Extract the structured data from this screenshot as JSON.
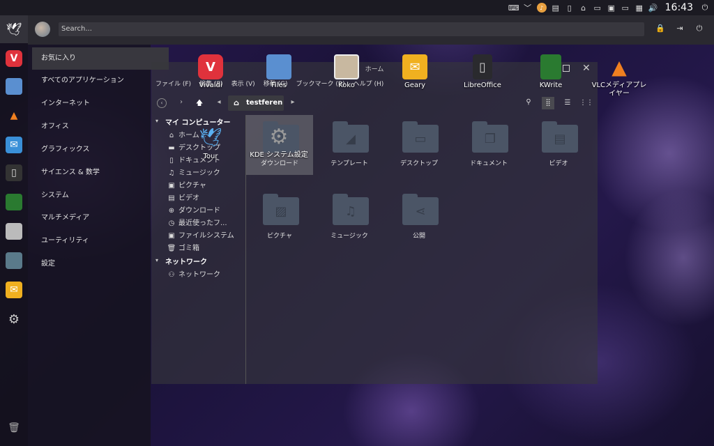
{
  "panel": {
    "clock": "16:43"
  },
  "menu": {
    "search_placeholder": "Search...",
    "categories": [
      "お気に入り",
      "すべてのアプリケーション",
      "インターネット",
      "オフィス",
      "グラフィックス",
      "サイエンス & 数学",
      "システム",
      "マルチメディア",
      "ユーティリティ",
      "設定"
    ]
  },
  "file_manager": {
    "title": "ホーム",
    "menubar": [
      "ファイル (F)",
      "編集 (E)",
      "表示 (V)",
      "移動 (G)",
      "ブックマーク (B)",
      "ヘルプ (H)"
    ],
    "breadcrumb": "testferen",
    "sidebar": {
      "my_computer": "マイ コンピューター",
      "places": [
        "ホーム",
        "デスクトップ",
        "ドキュメント",
        "ミュージック",
        "ピクチャ",
        "ビデオ",
        "ダウンロード",
        "最近使ったフ...",
        "ファイルシステム",
        "ゴミ箱"
      ],
      "network_group": "ネットワーク",
      "network_items": [
        "ネットワーク"
      ]
    },
    "folders": [
      "ダウンロード",
      "テンプレート",
      "デスクトップ",
      "ドキュメント",
      "ビデオ",
      "ピクチャ",
      "ミュージック",
      "公開"
    ]
  },
  "desktop_icons": {
    "vivaldi": "Vivaldi",
    "files": "Files",
    "koko": "Koko",
    "geary": "Geary",
    "libreoffice": "LibreOffice",
    "kwrite": "KWrite",
    "vlc": "VLCメディアプレイヤー",
    "tour": "Tour",
    "kde_settings": "KDE システム設定"
  },
  "colors": {
    "accent": "#e0323c",
    "folder": "#4b5566",
    "menu_bg": "#2a2930"
  }
}
